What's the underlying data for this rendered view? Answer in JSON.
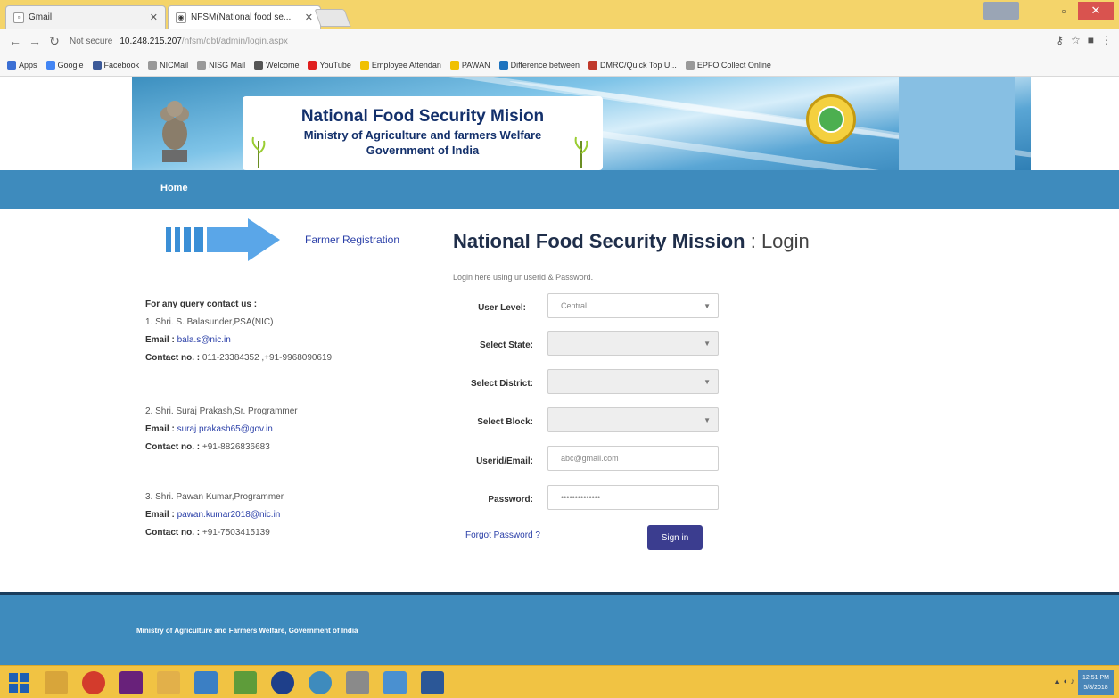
{
  "browser": {
    "tabs": [
      {
        "label": "Gmail",
        "active": false
      },
      {
        "label": "NFSM(National food se...",
        "active": true
      }
    ],
    "url_security": "Not secure",
    "url_host": "10.248.215.207",
    "url_path": "/nfsm/dbt/admin/login.aspx",
    "bookmarks": [
      {
        "label": "Apps",
        "color": "#3b6fd4"
      },
      {
        "label": "Google",
        "color": "#4285f4"
      },
      {
        "label": "Facebook",
        "color": "#3b5998"
      },
      {
        "label": "NICMail",
        "color": "#999999"
      },
      {
        "label": "NISG Mail",
        "color": "#999999"
      },
      {
        "label": "Welcome",
        "color": "#555555"
      },
      {
        "label": "YouTube",
        "color": "#e02020"
      },
      {
        "label": "Employee Attendan",
        "color": "#f0c000"
      },
      {
        "label": "PAWAN",
        "color": "#f0c000"
      },
      {
        "label": "Difference between",
        "color": "#1e73be"
      },
      {
        "label": "DMRC/Quick Top U...",
        "color": "#c0392b"
      },
      {
        "label": "EPFO:Collect Online",
        "color": "#999999"
      }
    ]
  },
  "header": {
    "title_line1": "National Food Security Mision",
    "title_line2": "Ministry of Agriculture and farmers Welfare",
    "title_line3": "Government of India"
  },
  "nav": {
    "home": "Home"
  },
  "left": {
    "farmer_registration": "Farmer Registration",
    "contact_heading": "For any query contact us :",
    "contacts": [
      {
        "name": "1. Shri. S. Balasunder,PSA(NIC)",
        "email_label": "Email :",
        "email": "bala.s@nic.in",
        "phone_label": "Contact no. :",
        "phone": "011-23384352 ,+91-9968090619"
      },
      {
        "name": "2. Shri. Suraj Prakash,Sr. Programmer",
        "email_label": "Email :",
        "email": "suraj.prakash65@gov.in",
        "phone_label": "Contact no. :",
        "phone": "+91-8826836683"
      },
      {
        "name": "3. Shri. Pawan Kumar,Programmer",
        "email_label": "Email :",
        "email": "pawan.kumar2018@nic.in",
        "phone_label": "Contact no. :",
        "phone": "+91-7503415139"
      }
    ]
  },
  "login": {
    "title_bold": "National Food Security Mission",
    "title_sub": ": Login",
    "hint": "Login here using ur userid & Password.",
    "user_level_label": "User Level:",
    "user_level_value": "Central",
    "state_label": "Select State:",
    "state_value": "",
    "district_label": "Select District:",
    "district_value": "",
    "block_label": "Select Block:",
    "block_value": "",
    "userid_label": "Userid/Email:",
    "userid_value": "abc@gmail.com",
    "password_label": "Password:",
    "password_value": "••••••••••••••",
    "forgot": "Forgot Password ?",
    "signin": "Sign in"
  },
  "footer": {
    "text": "Ministry of Agriculture and Farmers Welfare, Government of India"
  },
  "taskbar": {
    "clock_time": "12:51 PM",
    "clock_date": "5/8/2018"
  }
}
